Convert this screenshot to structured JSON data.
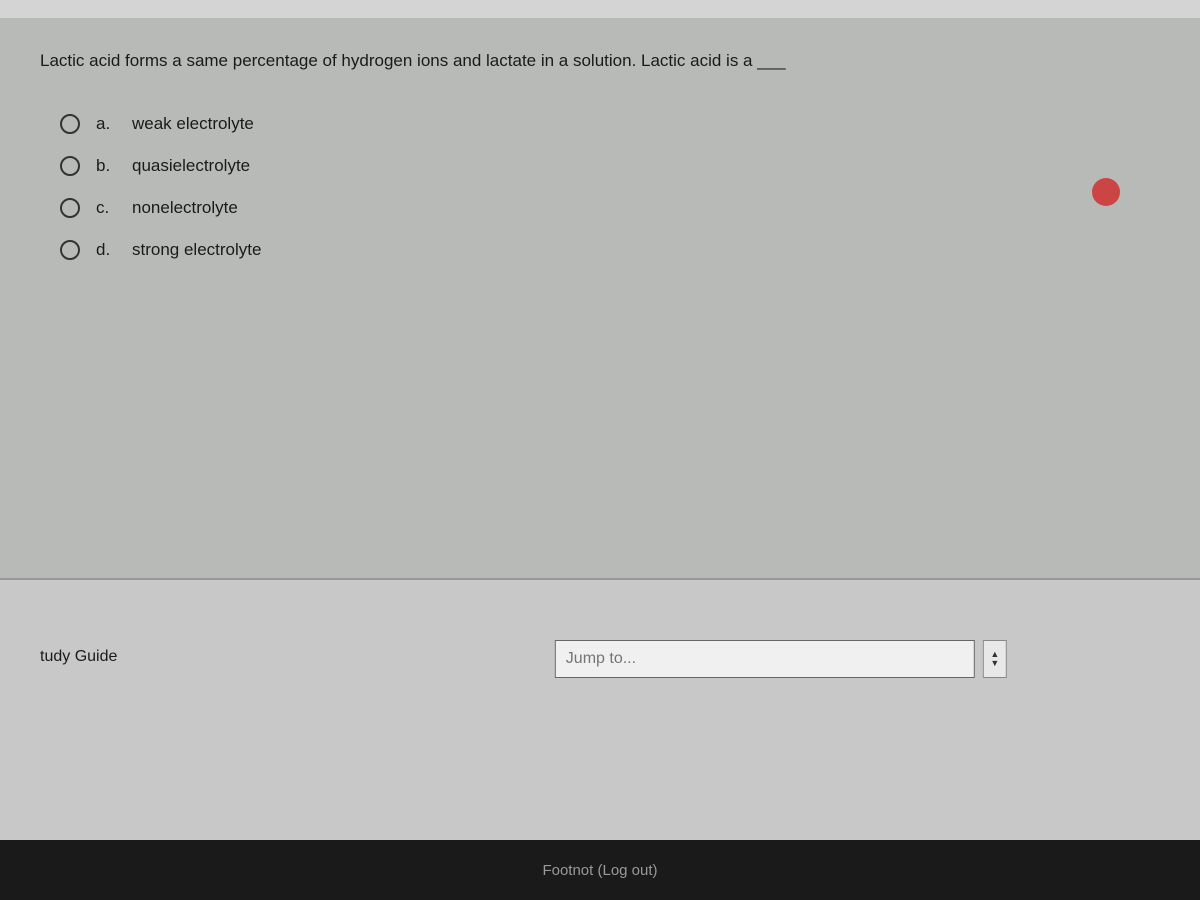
{
  "page": {
    "question": {
      "text": "Lactic acid forms a same percentage of hydrogen ions and lactate in a solution.  Lactic acid is a ___"
    },
    "options": [
      {
        "letter": "a.",
        "text": "weak electrolyte"
      },
      {
        "letter": "b.",
        "text": "quasielectrolyte"
      },
      {
        "letter": "c.",
        "text": "nonelectrolyte"
      },
      {
        "letter": "d.",
        "text": "strong electrolyte"
      }
    ],
    "jump_to": {
      "placeholder": "Jump to...",
      "label": "Jump to..."
    },
    "study_guide_label": "tudy Guide",
    "footer": {
      "text": "Footnot (Log out)"
    }
  }
}
